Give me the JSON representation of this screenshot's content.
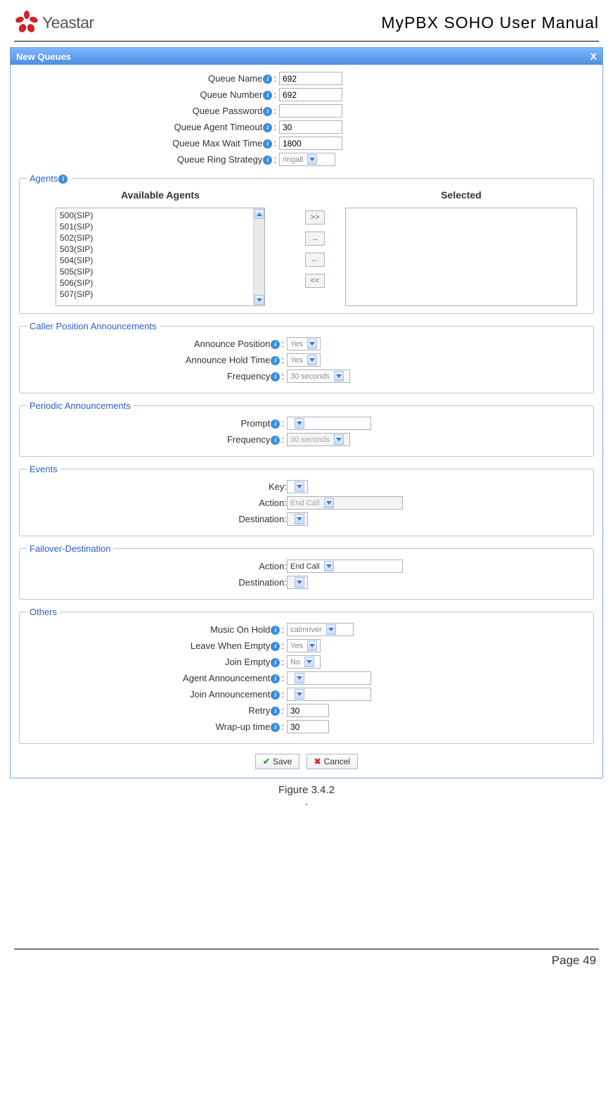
{
  "header": {
    "logo_text": "Yeastar",
    "doc_title": "MyPBX SOHO User Manual"
  },
  "window": {
    "title": "New Queues",
    "close": "X"
  },
  "basic": {
    "labels": {
      "queue_name": "Queue Name",
      "queue_number": "Queue Number",
      "queue_password": "Queue Password",
      "agent_timeout": "Queue Agent Timeout",
      "max_wait": "Queue Max Wait Time",
      "ring_strategy": "Queue Ring Strategy"
    },
    "values": {
      "queue_name": "692",
      "queue_number": "692",
      "queue_password": "",
      "agent_timeout": "30",
      "max_wait": "1800",
      "ring_strategy": "ringall"
    }
  },
  "agents": {
    "legend": "Agents",
    "available_title": "Available Agents",
    "selected_title": "Selected",
    "available": [
      "500(SIP)",
      "501(SIP)",
      "502(SIP)",
      "503(SIP)",
      "504(SIP)",
      "505(SIP)",
      "506(SIP)",
      "507(SIP)"
    ],
    "btn_all_right": ">>",
    "btn_right": "→",
    "btn_left": "←",
    "btn_all_left": "<<"
  },
  "caller_pos": {
    "legend": "Caller Position Announcements",
    "labels": {
      "announce_position": "Announce Position",
      "announce_hold": "Announce Hold Time",
      "frequency": "Frequency"
    },
    "values": {
      "announce_position": "Yes",
      "announce_hold": "Yes",
      "frequency": "30 seconds"
    }
  },
  "periodic": {
    "legend": "Periodic Announcements",
    "labels": {
      "prompt": "Prompt",
      "frequency": "Frequency"
    },
    "values": {
      "prompt": "",
      "frequency": "30 seconds"
    }
  },
  "events": {
    "legend": "Events",
    "labels": {
      "key": "Key:",
      "action": "Action:",
      "destination": "Destination:"
    },
    "values": {
      "key": "",
      "action": "End Call",
      "destination": ""
    }
  },
  "failover": {
    "legend": "Failover-Destination",
    "labels": {
      "action": "Action:",
      "destination": "Destination:"
    },
    "values": {
      "action": "End Call",
      "destination": ""
    }
  },
  "others": {
    "legend": "Others",
    "labels": {
      "moh": "Music On Hold",
      "leave_empty": "Leave When Empty",
      "join_empty": "Join Empty",
      "agent_ann": "Agent Announcement",
      "join_ann": "Join Announcement",
      "retry": "Retry",
      "wrapup": "Wrap-up time"
    },
    "values": {
      "moh": "calmriver",
      "leave_empty": "Yes",
      "join_empty": "No",
      "agent_ann": "",
      "join_ann": "",
      "retry": "30",
      "wrapup": "30"
    }
  },
  "buttons": {
    "save": "Save",
    "cancel": "Cancel"
  },
  "figure": {
    "caption": "Figure 3.4.2",
    "period": "."
  },
  "footer": {
    "page": "Page 49"
  }
}
